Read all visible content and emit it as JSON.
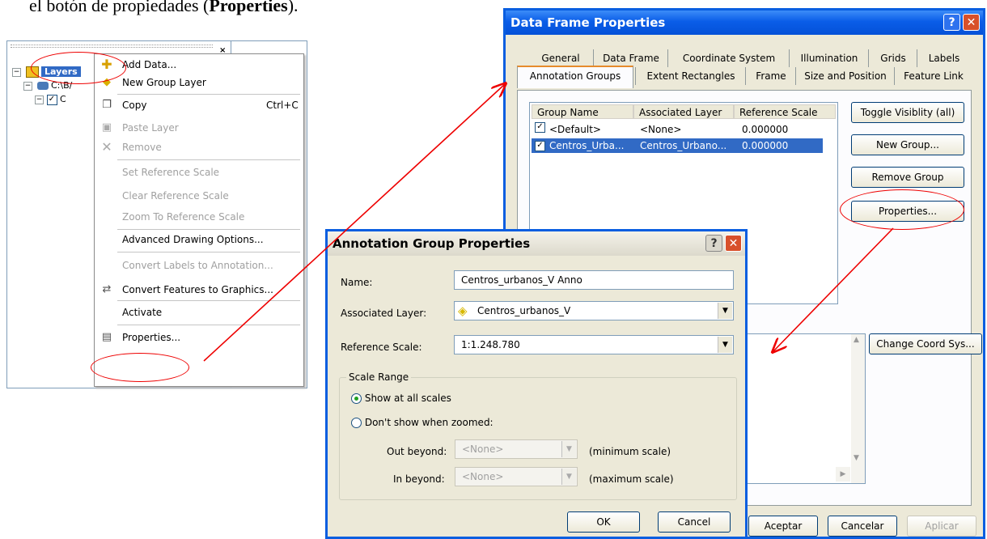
{
  "caption": {
    "prefix": "el botón de propiedades (",
    "bold": "Properties",
    "suffix": ")."
  },
  "toc": {
    "close_glyph": "×",
    "layers_label": "Layers",
    "row1_text": "C:\\B/",
    "row2_text": "C"
  },
  "context_menu": {
    "items": [
      {
        "label": "Add Data...",
        "icon": "add-data-icon",
        "enabled": true
      },
      {
        "label": "New Group Layer",
        "icon": "group-layer-icon",
        "enabled": true
      },
      {
        "label": "Copy",
        "shortcut": "Ctrl+C",
        "icon": "copy-icon",
        "enabled": true
      },
      {
        "label": "Paste Layer",
        "icon": "paste-icon",
        "enabled": false
      },
      {
        "label": "Remove",
        "icon": "remove-icon",
        "enabled": false
      },
      {
        "label": "Set Reference Scale",
        "enabled": false
      },
      {
        "label": "Clear Reference Scale",
        "enabled": false
      },
      {
        "label": "Zoom To Reference Scale",
        "enabled": false
      },
      {
        "label": "Advanced Drawing Options...",
        "enabled": true
      },
      {
        "label": "Convert Labels to Annotation...",
        "enabled": false
      },
      {
        "label": "Convert Features to Graphics...",
        "icon": "convert-icon",
        "enabled": true
      },
      {
        "label": "Activate",
        "enabled": true
      },
      {
        "label": "Properties...",
        "icon": "properties-icon",
        "enabled": true
      }
    ]
  },
  "data_frame_dialog": {
    "title": "Data Frame Properties",
    "help_glyph": "?",
    "close_glyph": "✕",
    "tabs_back": [
      "General",
      "Data Frame",
      "Coordinate System",
      "Illumination",
      "Grids",
      "Labels"
    ],
    "tabs_front": [
      "Annotation Groups",
      "Extent Rectangles",
      "Frame",
      "Size and Position",
      "Feature Link"
    ],
    "active_tab": "Annotation Groups",
    "columns": [
      "Group Name",
      "Associated Layer",
      "Reference Scale"
    ],
    "rows": [
      {
        "name": "<Default>",
        "layer": "<None>",
        "scale": "0.000000",
        "checked": true,
        "selected": false
      },
      {
        "name": "Centros_Urba...",
        "layer": "Centros_Urbano...",
        "scale": "0.000000",
        "checked": true,
        "selected": true
      }
    ],
    "buttons": {
      "toggle": "Toggle Visiblity (all)",
      "new_group": "New Group...",
      "remove_group": "Remove Group",
      "properties": "Properties...",
      "change_coord": "Change Coord Sys..."
    },
    "footer": {
      "ok": "Aceptar",
      "cancel": "Cancelar",
      "apply": "Aplicar"
    }
  },
  "annotation_dialog": {
    "title": "Annotation Group Properties",
    "help_glyph": "?",
    "close_glyph": "✕",
    "name_label": "Name:",
    "name_value": "Centros_urbanos_V Anno",
    "layer_label": "Associated Layer:",
    "layer_value": "Centros_urbanos_V",
    "scale_label": "Reference Scale:",
    "scale_value": "1:1.248.780",
    "scale_range_label": "Scale Range",
    "radio_all": "Show at all scales",
    "radio_zoom": "Don't show when zoomed:",
    "out_label": "Out beyond:",
    "out_value": "<None>",
    "out_hint": "(minimum scale)",
    "in_label": "In beyond:",
    "in_value": "<None>",
    "in_hint": "(maximum scale)",
    "ok": "OK",
    "cancel": "Cancel",
    "selected_radio": "Show at all scales"
  },
  "colors": {
    "annotation_red": "#e00000",
    "xp_title": "#0a5de8",
    "selection": "#316ac5"
  }
}
